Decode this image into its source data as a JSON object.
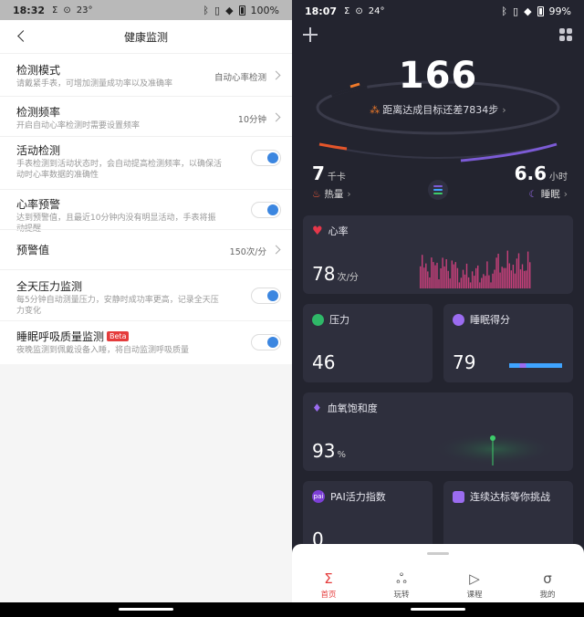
{
  "left": {
    "status": {
      "time": "18:32",
      "temp": "23°",
      "battery": "100%"
    },
    "header": {
      "title": "健康监测"
    },
    "items": [
      {
        "title": "检测模式",
        "desc": "请戴紧手表，可增加测量成功率以及准确率",
        "value": "自动心率检测"
      },
      {
        "title": "检测频率",
        "desc": "开启自动心率检测时需要设置频率",
        "value": "10分钟"
      },
      {
        "title": "活动检测",
        "desc": "手表检测到活动状态时，会自动提高检测频率，以确保活动时心率数据的准确性"
      },
      {
        "title": "心率预警",
        "desc": "达到预警值，且最近10分钟内没有明显活动，手表将振动提醒"
      },
      {
        "title": "预警值",
        "value": "150次/分"
      },
      {
        "title": "全天压力监测",
        "desc": "每5分钟自动测量压力，安静时成功率更高，记录全天压力变化"
      },
      {
        "title": "睡眠呼吸质量监测",
        "badge": "Beta",
        "desc": "夜晚监测到佩戴设备入睡，将自动监测呼吸质量"
      }
    ]
  },
  "right": {
    "status": {
      "time": "18:07",
      "temp": "24°",
      "battery": "99%"
    },
    "steps": "166",
    "goal_text": "距离达成目标还差7834步",
    "calories": {
      "value": "7",
      "unit": "千卡",
      "label": "热量"
    },
    "sleep": {
      "value": "6.6",
      "unit": "小时",
      "label": "睡眠"
    },
    "cards": {
      "heart": {
        "title": "心率",
        "value": "78",
        "unit": "次/分"
      },
      "stress": {
        "title": "压力",
        "value": "46"
      },
      "sleep_score": {
        "title": "睡眠得分",
        "value": "79"
      },
      "spo2": {
        "title": "血氧饱和度",
        "value": "93",
        "unit": "%"
      },
      "pai": {
        "title": "PAI活力指数",
        "badge": "pai",
        "value": "0"
      },
      "challenge": {
        "title": "连续达标等你挑战"
      }
    },
    "tabs": [
      {
        "label": "首页",
        "icon": "sigma-icon"
      },
      {
        "label": "玩转",
        "icon": "circles-icon"
      },
      {
        "label": "课程",
        "icon": "play-icon"
      },
      {
        "label": "我的",
        "icon": "user-icon"
      }
    ],
    "colors": {
      "accent_red": "#e53c3c",
      "toggle_blue": "#3b86e0",
      "heart_bars": "#c8407a",
      "sleep_blue": "#3fa4ff",
      "spo2_green": "#3dcc6a"
    }
  }
}
